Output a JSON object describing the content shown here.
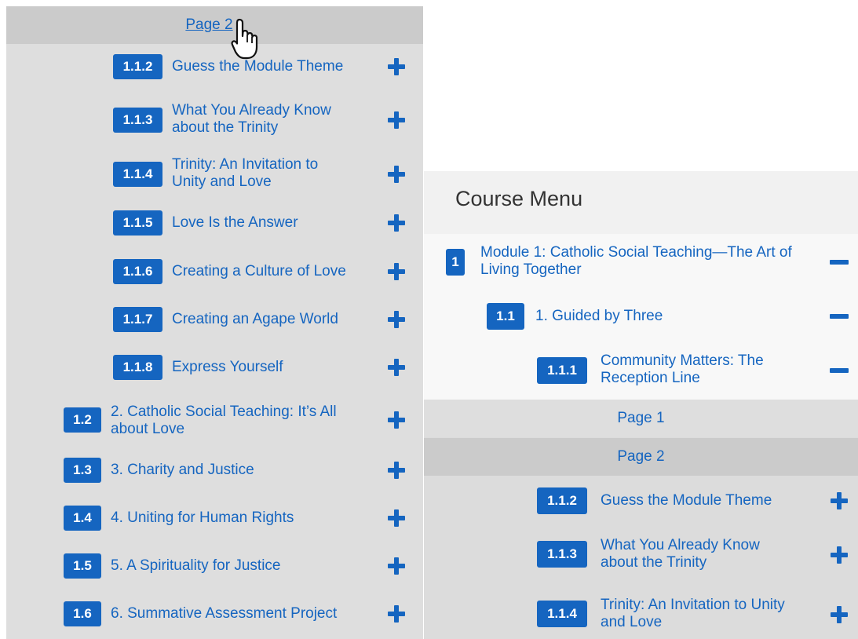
{
  "left_panel": {
    "page2_label": "Page 2",
    "items": [
      {
        "badge": "1.1.2",
        "label": "Guess the Module Theme"
      },
      {
        "badge": "1.1.3",
        "label": "What You Already Know about the Trinity"
      },
      {
        "badge": "1.1.4",
        "label": "Trinity: An Invitation to Unity and Love"
      },
      {
        "badge": "1.1.5",
        "label": "Love Is the Answer"
      },
      {
        "badge": "1.1.6",
        "label": "Creating a Culture of Love"
      },
      {
        "badge": "1.1.7",
        "label": "Creating an Agape World"
      },
      {
        "badge": "1.1.8",
        "label": "Express Yourself"
      },
      {
        "badge": "1.2",
        "label": "2. Catholic Social Teaching: It’s All about Love"
      },
      {
        "badge": "1.3",
        "label": "3. Charity and Justice"
      },
      {
        "badge": "1.4",
        "label": "4. Uniting for Human Rights"
      },
      {
        "badge": "1.5",
        "label": "5. A Spirituality for Justice"
      },
      {
        "badge": "1.6",
        "label": "6. Summative Assessment Project"
      }
    ]
  },
  "right_panel": {
    "title": "Course Menu",
    "module": {
      "badge": "1",
      "label": "Module 1: Catholic Social Teaching—The Art of Living Together"
    },
    "section": {
      "badge": "1.1",
      "label": "1. Guided by Three"
    },
    "lesson": {
      "badge": "1.1.1",
      "label": "Community Matters: The Reception Line"
    },
    "page1_label": "Page 1",
    "page2_label": "Page 2",
    "items": [
      {
        "badge": "1.1.2",
        "label": "Guess the Module Theme"
      },
      {
        "badge": "1.1.3",
        "label": "What You Already Know about the Trinity"
      },
      {
        "badge": "1.1.4",
        "label": "Trinity: An Invitation to Unity and Love"
      }
    ]
  },
  "colors": {
    "accent": "#1565c0",
    "panel_bg": "#dedede",
    "page_highlight": "#cbcbcb"
  },
  "icons": {
    "expand": "plus-icon",
    "collapse": "minus-icon",
    "cursor": "hand-pointer-icon"
  }
}
